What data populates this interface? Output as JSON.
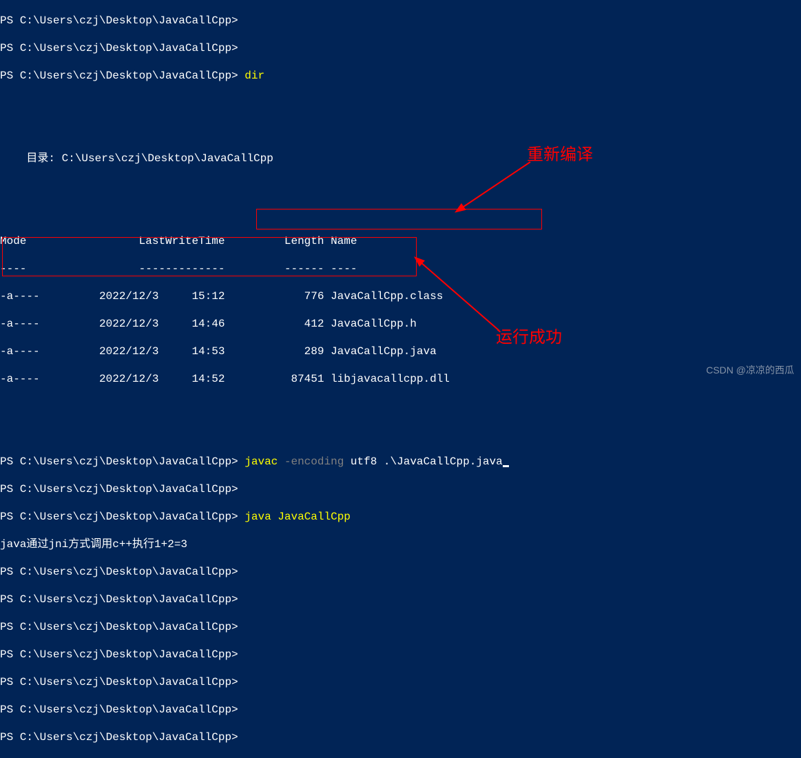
{
  "lines": {
    "l0": "PS C:\\Users\\czj\\Desktop\\JavaCallCpp>",
    "l1": "PS C:\\Users\\czj\\Desktop\\JavaCallCpp>",
    "l2_prompt": "PS C:\\Users\\czj\\Desktop\\JavaCallCpp> ",
    "l2_cmd": "dir",
    "dir_header": "    目录: C:\\Users\\czj\\Desktop\\JavaCallCpp",
    "col_headers": "Mode                 LastWriteTime         Length Name",
    "col_sep": "----                 -------------         ------ ----",
    "r1": "-a----         2022/12/3     15:12            776 JavaCallCpp.class",
    "r2": "-a----         2022/12/3     14:46            412 JavaCallCpp.h",
    "r3": "-a----         2022/12/3     14:53            289 JavaCallCpp.java",
    "r4": "-a----         2022/12/3     14:52          87451 libjavacallcpp.dll",
    "p3_prompt": "PS C:\\Users\\czj\\Desktop\\JavaCallCpp> ",
    "p3_cmd_a": "javac ",
    "p3_cmd_b": "-encoding",
    "p3_cmd_c": " utf8 .\\JavaCallCpp.java",
    "p4": "PS C:\\Users\\czj\\Desktop\\JavaCallCpp>",
    "p5_prompt": "PS C:\\Users\\czj\\Desktop\\JavaCallCpp> ",
    "p5_cmd": "java JavaCallCpp",
    "output": "java通过jni方式调用c++执行1+2=3",
    "p6": "PS C:\\Users\\czj\\Desktop\\JavaCallCpp>",
    "p7": "PS C:\\Users\\czj\\Desktop\\JavaCallCpp>",
    "p8": "PS C:\\Users\\czj\\Desktop\\JavaCallCpp>",
    "p9": "PS C:\\Users\\czj\\Desktop\\JavaCallCpp>",
    "p10": "PS C:\\Users\\czj\\Desktop\\JavaCallCpp>",
    "p11": "PS C:\\Users\\czj\\Desktop\\JavaCallCpp>",
    "p12": "PS C:\\Users\\czj\\Desktop\\JavaCallCpp>"
  },
  "annotations": {
    "recompile": "重新编译",
    "success": "运行成功"
  },
  "watermark": "CSDN @凉凉的西瓜"
}
